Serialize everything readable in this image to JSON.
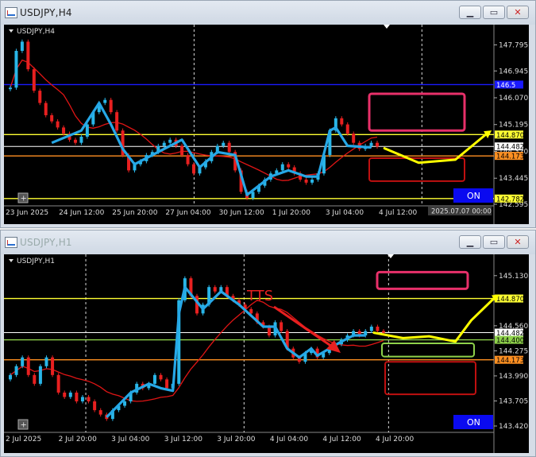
{
  "colors": {
    "bull": "#29b6e8",
    "bear": "#e82020",
    "ma": "#e01515",
    "trend": "#26a7e6",
    "yellow": "#ffff33",
    "orange": "#ff9022",
    "blue": "#1a1aff",
    "pink": "#e8306a",
    "darkred": "#c01010",
    "green": "#8ed14a",
    "forecast": "#ffff00"
  },
  "top": {
    "window_title": "USDJPY,H4",
    "chart_label": "USDJPY,H4",
    "on_label": "ON",
    "time_tag": "2025.07.07 00:00",
    "buttons": [
      "minimize-button",
      "maximize-button",
      "close-button"
    ],
    "chart_data": {
      "type": "candlestick",
      "symbol": "USDJPY",
      "timeframe": "H4",
      "ylim": [
        142.595,
        148.3
      ],
      "y_ticks": [
        "147.795",
        "146.945",
        "146.070",
        "145.195",
        "144.320",
        "143.445",
        "142.595"
      ],
      "x_ticks": [
        "23 Jun 2025",
        "24 Jun 12:00",
        "25 Jun 20:00",
        "27 Jun 04:00",
        "30 Jun 12:00",
        "1 Jul 20:00",
        "3 Jul 04:00",
        "4 Jul 12:00"
      ],
      "levels": [
        {
          "price": 146.5,
          "color": "blue",
          "label": "146.5"
        },
        {
          "price": 144.87,
          "color": "yellow",
          "label": "144.870"
        },
        {
          "price": 144.482,
          "color": "white",
          "label": "144.482"
        },
        {
          "price": 144.173,
          "color": "orange",
          "label": "144.173"
        },
        {
          "price": 142.782,
          "color": "yellow",
          "label": "142.782"
        }
      ],
      "closes": [
        146.4,
        147.6,
        147.9,
        147.0,
        146.3,
        145.9,
        145.5,
        145.3,
        145.1,
        144.9,
        144.7,
        144.6,
        144.8,
        145.2,
        145.6,
        145.9,
        146.0,
        145.6,
        145.0,
        144.2,
        143.7,
        143.9,
        144.0,
        144.2,
        144.3,
        144.5,
        144.6,
        144.7,
        144.5,
        144.2,
        143.9,
        143.6,
        143.8,
        144.0,
        144.3,
        144.5,
        144.6,
        144.3,
        143.7,
        143.0,
        142.8,
        143.0,
        143.2,
        143.4,
        143.6,
        143.7,
        143.9,
        143.8,
        143.6,
        143.4,
        143.3,
        143.4,
        143.6,
        144.2,
        145.0,
        145.4,
        145.2,
        144.9,
        144.6,
        144.4,
        144.5,
        144.6,
        144.48
      ],
      "trendline": [
        [
          7,
          144.6
        ],
        [
          12,
          145.0
        ],
        [
          15,
          145.9
        ],
        [
          17,
          145.2
        ],
        [
          19,
          144.4
        ],
        [
          21,
          143.9
        ],
        [
          24,
          144.2
        ],
        [
          29,
          144.7
        ],
        [
          32,
          143.8
        ],
        [
          35,
          144.3
        ],
        [
          38,
          144.2
        ],
        [
          40,
          142.9
        ],
        [
          44,
          143.5
        ],
        [
          47,
          143.7
        ],
        [
          50,
          143.5
        ],
        [
          52,
          143.5
        ],
        [
          54,
          145.0
        ],
        [
          55,
          145.1
        ],
        [
          57,
          144.5
        ],
        [
          61,
          144.45
        ]
      ],
      "forecast_path": [
        [
          0.725,
          144.42
        ],
        [
          0.79,
          143.95
        ],
        [
          0.86,
          144.05
        ],
        [
          0.92,
          144.9
        ]
      ],
      "zones": [
        {
          "type": "sell",
          "price_top": 146.2,
          "price_bottom": 145.0,
          "color": "pink"
        },
        {
          "type": "buy",
          "price_top": 144.1,
          "price_bottom": 143.35,
          "color": "darkred"
        }
      ]
    }
  },
  "bottom": {
    "window_title": "USDJPY,H1",
    "chart_label": "USDJPY,H1",
    "annotation": "TTS",
    "on_label": "ON",
    "buttons": [
      "minimize-button",
      "maximize-button",
      "close-button"
    ],
    "chart_data": {
      "type": "candlestick",
      "symbol": "USDJPY",
      "timeframe": "H1",
      "ylim": [
        143.42,
        145.3
      ],
      "y_ticks": [
        "145.130",
        "144.560",
        "144.275",
        "143.990",
        "143.705",
        "143.420"
      ],
      "x_ticks": [
        "2 Jul 2025",
        "2 Jul 20:00",
        "3 Jul 04:00",
        "3 Jul 12:00",
        "3 Jul 20:00",
        "4 Jul 04:00",
        "4 Jul 12:00",
        "4 Jul 20:00"
      ],
      "levels": [
        {
          "price": 144.87,
          "color": "yellow",
          "label": "144.870"
        },
        {
          "price": 144.482,
          "color": "white",
          "label": "144.482"
        },
        {
          "price": 144.4,
          "color": "green",
          "label": "144.400"
        },
        {
          "price": 144.173,
          "color": "orange",
          "label": "144.173"
        }
      ],
      "closes": [
        144.0,
        144.1,
        144.2,
        144.0,
        143.9,
        144.1,
        144.2,
        144.0,
        143.8,
        143.75,
        143.8,
        143.7,
        143.75,
        143.7,
        143.6,
        143.55,
        143.5,
        143.6,
        143.65,
        143.7,
        143.8,
        143.9,
        143.85,
        143.9,
        144.0,
        143.95,
        143.85,
        143.9,
        144.85,
        145.1,
        144.9,
        144.7,
        144.8,
        145.0,
        144.95,
        145.0,
        144.9,
        144.85,
        144.8,
        144.75,
        144.7,
        144.6,
        144.55,
        144.45,
        144.6,
        144.5,
        144.3,
        144.2,
        144.15,
        144.25,
        144.3,
        144.2,
        144.25,
        144.3,
        144.35,
        144.4,
        144.45,
        144.5,
        144.45,
        144.5,
        144.55,
        144.5,
        144.48
      ],
      "trendline": [
        [
          16,
          143.52
        ],
        [
          20,
          143.8
        ],
        [
          23,
          143.9
        ],
        [
          25,
          143.85
        ],
        [
          27,
          143.82
        ],
        [
          28,
          144.7
        ],
        [
          29,
          145.0
        ],
        [
          32,
          144.75
        ],
        [
          35,
          144.95
        ],
        [
          38,
          144.8
        ],
        [
          42,
          144.55
        ],
        [
          44,
          144.55
        ],
        [
          46,
          144.3
        ],
        [
          48,
          144.2
        ],
        [
          50,
          144.3
        ],
        [
          51,
          144.22
        ],
        [
          55,
          144.38
        ],
        [
          57,
          144.45
        ],
        [
          59,
          144.45
        ]
      ],
      "forecast_path": [
        [
          0.705,
          144.48
        ],
        [
          0.76,
          144.42
        ],
        [
          0.81,
          144.44
        ],
        [
          0.86,
          144.38
        ],
        [
          0.89,
          144.62
        ],
        [
          0.935,
          144.88
        ]
      ],
      "zones": [
        {
          "type": "sell",
          "price_top": 145.17,
          "price_bottom": 144.98,
          "color": "pink"
        },
        {
          "type": "buy",
          "price_top": 144.36,
          "price_bottom": 144.21,
          "color": "green"
        },
        {
          "type": "buy",
          "price_top": 144.15,
          "price_bottom": 143.78,
          "color": "darkred"
        }
      ]
    }
  }
}
